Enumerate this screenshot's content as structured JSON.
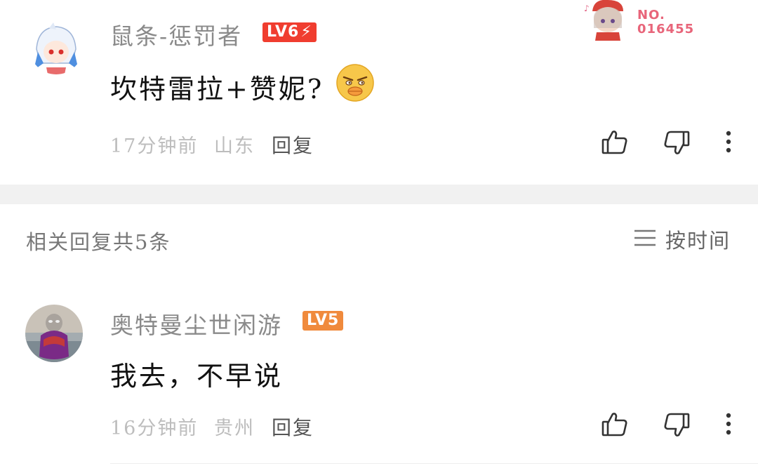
{
  "top_comment": {
    "username": "鼠条-惩罚者",
    "level": "LV6",
    "text": "坎特雷拉+赞妮?",
    "time": "17分钟前",
    "location": "山东",
    "reply_label": "回复"
  },
  "fan_badge": {
    "no_label": "NO.",
    "number": "016455"
  },
  "replies_header": {
    "title": "相关回复共5条",
    "sort_label": "按时间"
  },
  "reply_comment": {
    "username": "奥特曼尘世闲游",
    "level": "LV5",
    "text": "我去，不早说",
    "time": "16分钟前",
    "location": "贵州",
    "reply_label": "回复"
  },
  "colors": {
    "lv6_badge": "#f03d2f",
    "lv5_badge": "#f08a3c",
    "divider": "#f1f1f1",
    "meta_text": "#bdbdbd"
  },
  "icons": [
    "thumbs-up-icon",
    "thumbs-down-icon",
    "more-vertical-icon",
    "sort-list-icon"
  ]
}
